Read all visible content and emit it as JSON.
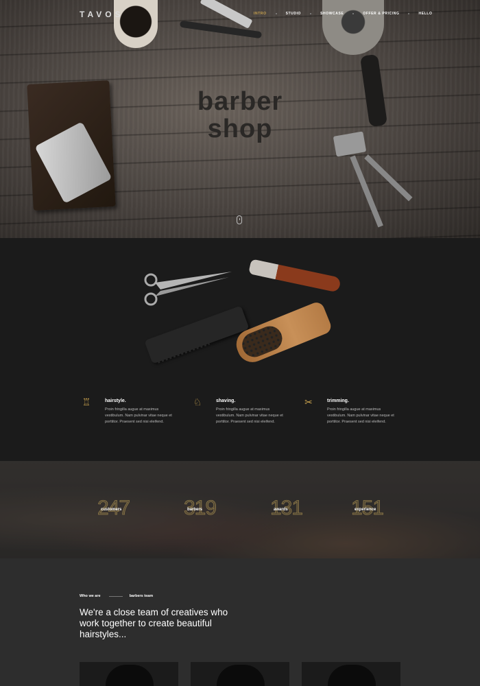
{
  "header": {
    "logo": "TAVOS",
    "nav": [
      {
        "label": "INTRO",
        "active": true
      },
      {
        "label": "STUDIO",
        "active": false
      },
      {
        "label": "SHOWCASE",
        "active": false
      },
      {
        "label": "OFFER & PRICING",
        "active": false
      },
      {
        "label": "HELLO",
        "active": false
      }
    ]
  },
  "hero": {
    "title_line1": "barber",
    "title_line2": "shop",
    "scroll_icon": "mouse-scroll-icon"
  },
  "features": [
    {
      "icon": "hairstyle-icon",
      "glyph": "♖",
      "title": "hairstyle.",
      "text": "Proin fringilla augue at maximus vestibulum. Nam pulvinar vitae neque et porttitor. Praesent sed nisi eleifend."
    },
    {
      "icon": "barber-chair-icon",
      "glyph": "♘",
      "title": "shaving.",
      "text": "Proin fringilla augue at maximus vestibulum. Nam pulvinar vitae neque et porttitor. Praesent sed nisi eleifend."
    },
    {
      "icon": "scissors-icon",
      "glyph": "✂",
      "title": "trimming.",
      "text": "Proin fringilla augue at maximus vestibulum. Nam pulvinar vitae neque et porttitor. Praesent sed nisi eleifend."
    }
  ],
  "stats": [
    {
      "number": "247",
      "label": "customers"
    },
    {
      "number": "319",
      "label": "barbers"
    },
    {
      "number": "131",
      "label": "awards"
    },
    {
      "number": "151",
      "label": "experience"
    }
  ],
  "team": {
    "kicker": "Who we are",
    "kicker_right": "barbers team",
    "heading": "We're a close team of creatives who work together to create beautiful hairstyles..."
  },
  "colors": {
    "accent": "#c9a24d",
    "dark": "#1b1b1b"
  }
}
